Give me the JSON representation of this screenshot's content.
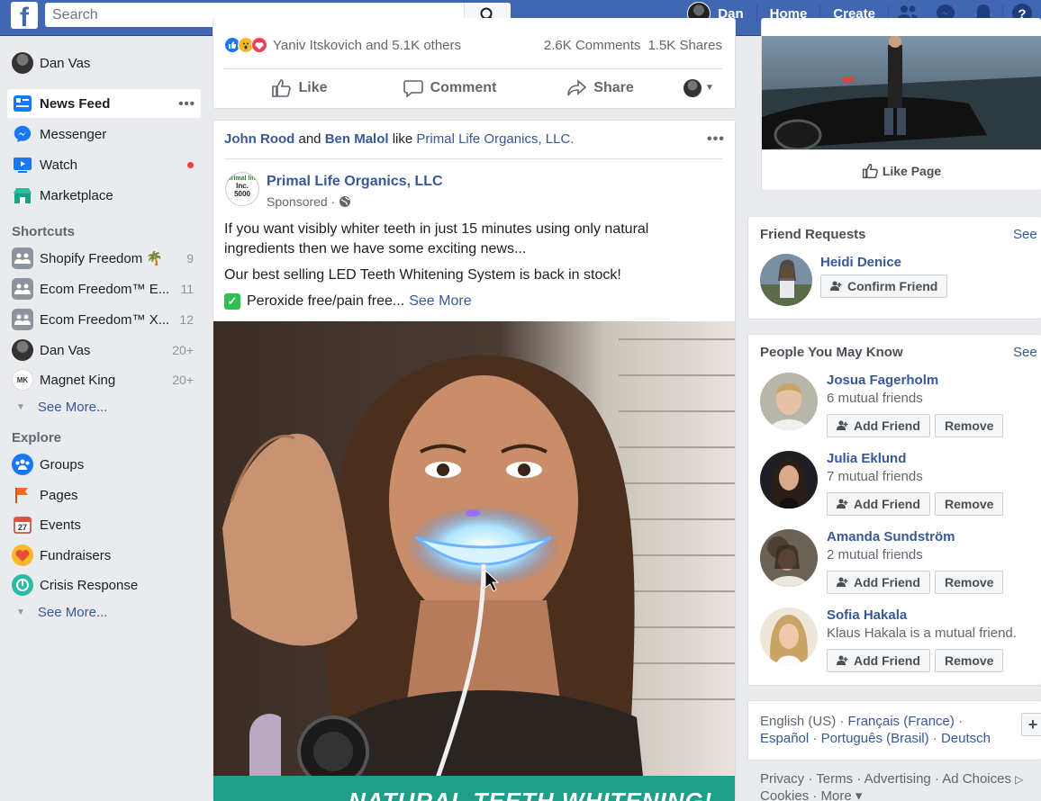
{
  "topbar": {
    "logo": "f",
    "search_placeholder": "Search",
    "user_name": "Dan",
    "home": "Home",
    "create": "Create"
  },
  "leftnav": {
    "profile_name": "Dan Vas",
    "items": [
      {
        "label": "News Feed"
      },
      {
        "label": "Messenger"
      },
      {
        "label": "Watch"
      },
      {
        "label": "Marketplace"
      }
    ],
    "more_dots": "•••",
    "shortcuts_heading": "Shortcuts",
    "shortcuts": [
      {
        "label": "Shopify Freedom 🌴",
        "count": "9"
      },
      {
        "label": "Ecom Freedom™ E...",
        "count": "11"
      },
      {
        "label": "Ecom Freedom™ X...",
        "count": "12"
      },
      {
        "label": "Dan Vas",
        "count": "20+"
      },
      {
        "label": "Magnet King",
        "count": "20+"
      }
    ],
    "see_more": "See More...",
    "explore_heading": "Explore",
    "explore": [
      {
        "label": "Groups"
      },
      {
        "label": "Pages"
      },
      {
        "label": "Events"
      },
      {
        "label": "Fundraisers"
      },
      {
        "label": "Crisis Response"
      }
    ],
    "events_day": "27",
    "magnet_initials": "MK"
  },
  "post1": {
    "reactions_text": "Yaniv Itskovich and 5.1K others",
    "comments": "2.6K Comments",
    "shares": "1.5K Shares",
    "like": "Like",
    "comment": "Comment",
    "share": "Share"
  },
  "post2": {
    "friend1": "John Rood",
    "and": "and",
    "friend2": "Ben Malol",
    "like_word": "like",
    "page_liked": "Primal Life Organics, LLC.",
    "page_name": "Primal Life Organics, LLC",
    "sponsored": "Sponsored ·",
    "text1": "If you want visibly whiter teeth in just 15 minutes using only natural ingredients then we have some exciting news...",
    "text2": "Our best selling LED Teeth Whitening System is back in stock!",
    "text3": "Peroxide free/pain free...",
    "see_more": "See More",
    "banner_text": "NATURAL TEETH WHITENING!",
    "logo_top": "primal life",
    "logo_mid": "Inc.",
    "logo_num": "5000"
  },
  "right": {
    "like_page": "Like Page",
    "friend_requests_title": "Friend Requests",
    "see": "See",
    "request_name": "Heidi Denice",
    "confirm_friend": "Confirm Friend",
    "pymk_title": "People You May Know",
    "add_friend": "Add Friend",
    "remove": "Remove",
    "people": [
      {
        "name": "Josua Fagerholm",
        "mutual": "6 mutual friends"
      },
      {
        "name": "Julia Eklund",
        "mutual": "7 mutual friends"
      },
      {
        "name": "Amanda Sundström",
        "mutual": "2 mutual friends"
      },
      {
        "name": "Sofia Hakala",
        "mutual": "Klaus Hakala is a mutual friend."
      }
    ],
    "lang_current": "English (US) ·",
    "lang1": "Français (France)",
    "lang2": "Español",
    "lang3": "Português (Brasil)",
    "lang4": "Deutsch",
    "dot": "·",
    "plus": "+",
    "footer1": "Privacy · Terms · Advertising · Ad Choices",
    "footer2": "Cookies · More ▾"
  },
  "colors": {
    "brand": "#4267b2",
    "link": "#385898",
    "background": "#e9ebee"
  }
}
